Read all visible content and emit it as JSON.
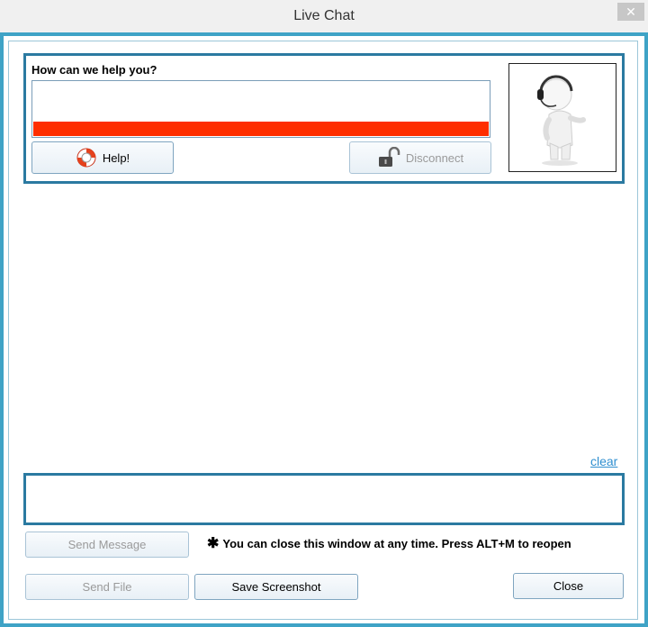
{
  "window": {
    "title": "Live Chat",
    "close_glyph": "✕"
  },
  "help_panel": {
    "prompt": "How can we help you?",
    "input_value": "",
    "help_button": "Help!",
    "disconnect_button": "Disconnect",
    "help_icon": "lifebuoy-icon",
    "disconnect_icon": "unlocked-padlock-icon",
    "avatar_icon": "support-agent-headset-icon"
  },
  "chat": {
    "clear_link": "clear",
    "message_value": ""
  },
  "footer": {
    "send_message": "Send Message",
    "hint_star": "✱",
    "hint_text": "You can close this window at any time. Press ALT+M to reopen",
    "send_file": "Send File",
    "save_screenshot": "Save Screenshot",
    "close": "Close"
  },
  "colors": {
    "frame": "#3fa3c6",
    "panel_border": "#2b7aa1",
    "alert_bar": "#fe2e00",
    "link": "#2f8fd0"
  }
}
